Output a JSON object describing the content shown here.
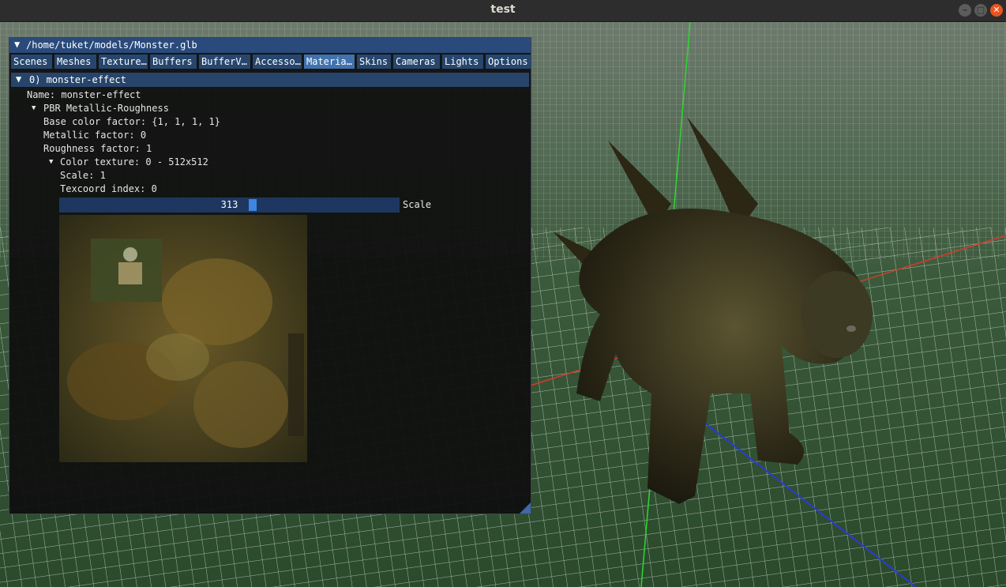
{
  "window": {
    "title": "test"
  },
  "window_controls": {
    "minimize": "–",
    "maximize": "□",
    "close": "✕"
  },
  "imgui": {
    "title_arrow": "▼",
    "file_path": "/home/tuket/models/Monster.glb",
    "tabs": [
      {
        "label": "Scenes"
      },
      {
        "label": "Meshes"
      },
      {
        "label": "Texture…"
      },
      {
        "label": "Buffers"
      },
      {
        "label": "BufferV…"
      },
      {
        "label": "Accesso…"
      },
      {
        "label": "Materia…"
      },
      {
        "label": "Skins"
      },
      {
        "label": "Cameras"
      },
      {
        "label": "Lights"
      },
      {
        "label": "Options"
      }
    ],
    "active_tab": "Materia…",
    "material": {
      "header_arrow": "▼",
      "header": "0) monster-effect",
      "name_line": "Name: monster-effect",
      "pbr_label": "PBR Metallic-Roughness",
      "base_color": "Base color factor: {1, 1, 1, 1}",
      "metallic": "Metallic factor: 0",
      "roughness": "Roughness factor: 1",
      "color_texture": "Color texture: 0 - 512x512",
      "scale": "Scale: 1",
      "texcoord": "Texcoord index: 0",
      "tree_arrow": "▼"
    },
    "slider": {
      "value": "313",
      "label": "Scale",
      "fraction": 0.57
    }
  },
  "icons": [
    "collapse-arrow-icon",
    "tree-node-arrow-icon",
    "resize-grip-icon",
    "minimize-icon",
    "maximize-icon",
    "close-icon"
  ],
  "colors": {
    "title_bg": "#294a7a",
    "tab": "#26466e",
    "tab_active": "#4172ad",
    "slider_grab": "#3d85e0",
    "close_button": "#e95420",
    "grid_line": "#c8d6c8"
  }
}
